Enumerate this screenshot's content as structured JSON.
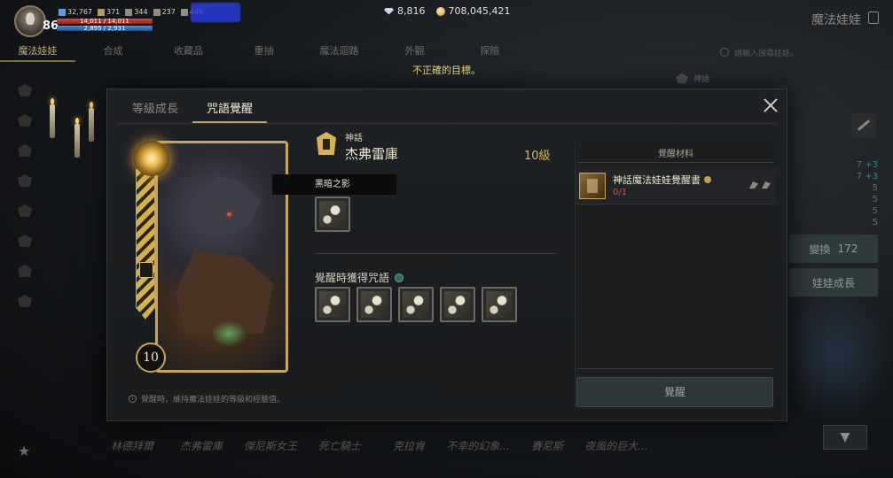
{
  "hud": {
    "level": "86",
    "stat1": "32,767",
    "stat2": "371",
    "stat3": "344",
    "stat4": "237",
    "stat5": "449",
    "hp": "14,011 / 14,011",
    "mp": "2,895 / 2,931",
    "gems": "8,816",
    "gold": "708,045,421",
    "page_title": "魔法娃娃"
  },
  "nav": {
    "items": [
      "魔法娃娃",
      "合成",
      "收藏品",
      "重抽",
      "魔法迴路",
      "外觀",
      "探險"
    ],
    "search_placeholder": "請輸入搜尋娃娃。"
  },
  "toast": "不正確的目標。",
  "background": {
    "ghost_item": "神話",
    "right_values": [
      {
        "value": "7",
        "plus": "+3"
      },
      {
        "value": "7",
        "plus": "+3"
      },
      {
        "value": "5",
        "plus": ""
      },
      {
        "value": "5",
        "plus": ""
      },
      {
        "value": "5",
        "plus": ""
      },
      {
        "value": "5",
        "plus": ""
      }
    ],
    "exchange_label": "變換",
    "exchange_value": "172",
    "growth_label": "娃娃成長",
    "bottom_names": [
      "林德拜爾",
      "杰弗雷庫",
      "傑尼斯女王",
      "死亡騎士",
      "克拉肯",
      "不幸的幻象...",
      "賽尼斯",
      "夜風的巨大..."
    ]
  },
  "modal": {
    "tabs": [
      "等級成長",
      "咒語覺醒"
    ],
    "active_tab": 1,
    "rarity": "神話",
    "doll_name": "杰弗雷庫",
    "doll_level": "10級",
    "card_level": "10",
    "tooltip": "黑暗之影",
    "awaken_spells_label": "覺醒時獲得咒語",
    "note": "覺醒時，維持魔法娃娃的等級和經驗值。",
    "materials": {
      "header": "覺醒材料",
      "item_name": "神話魔法娃娃覺醒書",
      "item_count": "0/1"
    },
    "awaken_button": "覺醒"
  }
}
